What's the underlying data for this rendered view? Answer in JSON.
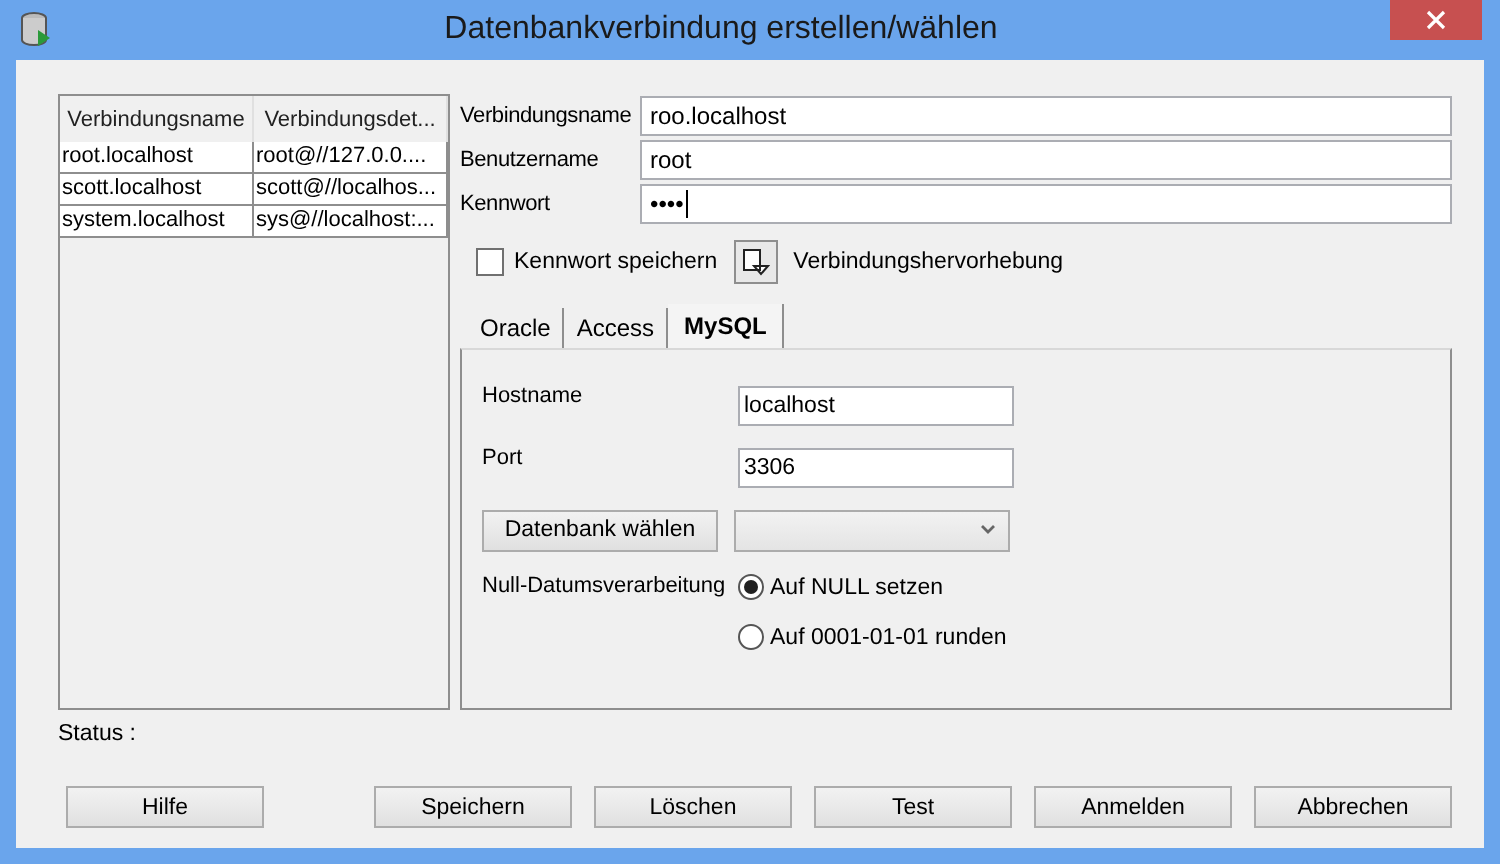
{
  "window": {
    "title": "Datenbankverbindung erstellen/wählen"
  },
  "connections_table": {
    "columns": [
      "Verbindungsname",
      "Verbindungsdet..."
    ],
    "rows": [
      [
        "root.localhost",
        "root@//127.0.0...."
      ],
      [
        "scott.localhost",
        "scott@//localhos..."
      ],
      [
        "system.localhost",
        "sys@//localhost:..."
      ]
    ]
  },
  "form": {
    "fields": [
      {
        "label": "Verbindungsname",
        "value": "roo.localhost"
      },
      {
        "label": "Benutzername",
        "value": "root"
      },
      {
        "label": "Kennwort",
        "value": "••••"
      }
    ]
  },
  "save_password": {
    "label": "Kennwort speichern",
    "checked": false
  },
  "highlight": {
    "label": "Verbindungshervorhebung"
  },
  "tabs": [
    {
      "label": "Oracle",
      "selected": false
    },
    {
      "label": "Access",
      "selected": false
    },
    {
      "label": "MySQL",
      "selected": true
    }
  ],
  "mysql": {
    "fields": [
      {
        "label": "Hostname",
        "value": "localhost"
      },
      {
        "label": "Port",
        "value": "3306"
      }
    ],
    "db_button": "Datenbank wählen",
    "null_label": "Null-Datumsverarbeitung",
    "options": [
      {
        "label": "Auf NULL setzen",
        "selected": true
      },
      {
        "label": "Auf 0001-01-01 runden",
        "selected": false
      }
    ]
  },
  "status": {
    "label": "Status :"
  },
  "buttons": [
    "Hilfe",
    "Speichern",
    "Löschen",
    "Test",
    "Anmelden",
    "Abbrechen"
  ]
}
